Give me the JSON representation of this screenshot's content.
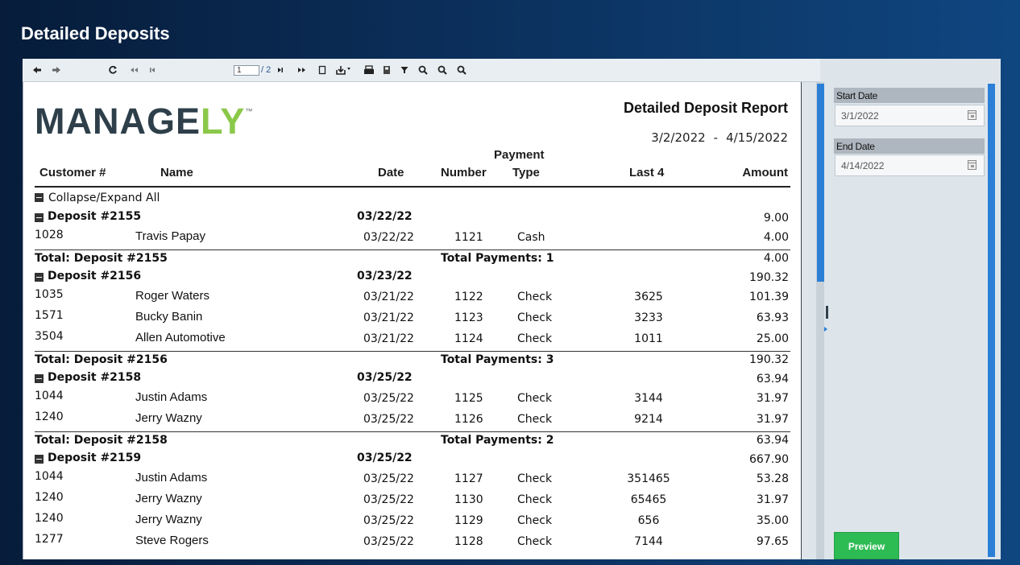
{
  "page": {
    "title": "Detailed Deposits"
  },
  "toolbar": {
    "current_page": "1",
    "page_total": "/ 2",
    "icons": [
      "undo-icon",
      "redo-icon",
      "refresh-icon",
      "first-page-icon",
      "previous-page-icon",
      "next-page-icon",
      "last-page-icon",
      "new-page-icon",
      "export-icon",
      "print-icon",
      "save-icon",
      "filter-icon",
      "zoom-in-icon",
      "zoom-out-icon",
      "zoom-fit-icon"
    ]
  },
  "report": {
    "logo_main": "MANAGE",
    "logo_accent": "LY",
    "logo_tm": "™",
    "title": "Detailed Deposit Report",
    "date_from": "3/2/2022",
    "date_sep": "-",
    "date_to": "4/15/2022",
    "headers": {
      "customer": "Customer #",
      "name": "Name",
      "date": "Date",
      "payment_group": "Payment",
      "number": "Number",
      "type": "Type",
      "last4": "Last 4",
      "amount": "Amount"
    },
    "collapse_label": "Collapse/Expand All",
    "deposits": [
      {
        "label": "Deposit #2155",
        "date": "03/22/22",
        "amount": "9.00",
        "rows": [
          {
            "customer": "1028",
            "name": "Travis Papay",
            "date": "03/22/22",
            "number": "1121",
            "type": "Cash",
            "last4": "",
            "amount": "4.00"
          }
        ],
        "total_label": "Total: Deposit  #2155",
        "total_payments": "Total Payments: 1",
        "total_amount": "4.00"
      },
      {
        "label": "Deposit #2156",
        "date": "03/23/22",
        "amount": "190.32",
        "rows": [
          {
            "customer": "1035",
            "name": "Roger Waters",
            "date": "03/21/22",
            "number": "1122",
            "type": "Check",
            "last4": "3625",
            "amount": "101.39"
          },
          {
            "customer": "1571",
            "name": "Bucky Banin",
            "date": "03/21/22",
            "number": "1123",
            "type": "Check",
            "last4": "3233",
            "amount": "63.93"
          },
          {
            "customer": "3504",
            "name": "Allen Automotive",
            "date": "03/21/22",
            "number": "1124",
            "type": "Check",
            "last4": "1011",
            "amount": "25.00"
          }
        ],
        "total_label": "Total: Deposit  #2156",
        "total_payments": "Total Payments: 3",
        "total_amount": "190.32"
      },
      {
        "label": "Deposit #2158",
        "date": "03/25/22",
        "amount": "63.94",
        "rows": [
          {
            "customer": "1044",
            "name": "Justin Adams",
            "date": "03/25/22",
            "number": "1125",
            "type": "Check",
            "last4": "3144",
            "amount": "31.97"
          },
          {
            "customer": "1240",
            "name": "Jerry Wazny",
            "date": "03/25/22",
            "number": "1126",
            "type": "Check",
            "last4": "9214",
            "amount": "31.97"
          }
        ],
        "total_label": "Total: Deposit  #2158",
        "total_payments": "Total Payments: 2",
        "total_amount": "63.94"
      },
      {
        "label": "Deposit #2159",
        "date": "03/25/22",
        "amount": "667.90",
        "rows": [
          {
            "customer": "1044",
            "name": "Justin Adams",
            "date": "03/25/22",
            "number": "1127",
            "type": "Check",
            "last4": "351465",
            "amount": "53.28"
          },
          {
            "customer": "1240",
            "name": "Jerry Wazny",
            "date": "03/25/22",
            "number": "1130",
            "type": "Check",
            "last4": "65465",
            "amount": "31.97"
          },
          {
            "customer": "1240",
            "name": "Jerry Wazny",
            "date": "03/25/22",
            "number": "1129",
            "type": "Check",
            "last4": "656",
            "amount": "35.00"
          },
          {
            "customer": "1277",
            "name": "Steve Rogers",
            "date": "03/25/22",
            "number": "1128",
            "type": "Check",
            "last4": "7144",
            "amount": "97.65"
          }
        ]
      }
    ]
  },
  "side_panel": {
    "start_label": "Start Date",
    "start_value": "3/1/2022",
    "end_label": "End Date",
    "end_value": "4/14/2022",
    "preview_label": "Preview"
  },
  "colors": {
    "accent_green": "#8bc84a",
    "scroll_blue": "#2b7fd6",
    "preview_green": "#2dbb54"
  }
}
